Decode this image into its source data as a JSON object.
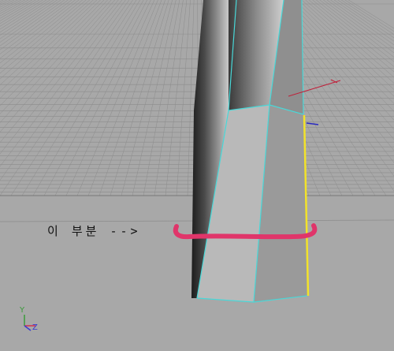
{
  "viewport": {
    "annotation_text": "이 부분 -->",
    "axis_labels": {
      "y": "Y",
      "z": "Z"
    },
    "colors": {
      "background": "#a8a8a8",
      "grid": "#8c8c8c",
      "grid_horizon": "#777777",
      "wireframe_highlight": "#48d8d8",
      "selected_edge": "#f2e22a",
      "annotation_stroke": "#e0356a",
      "axis_y": "#3a9a3a",
      "axis_x": "#d03050",
      "axis_z": "#3a3ad0"
    }
  }
}
